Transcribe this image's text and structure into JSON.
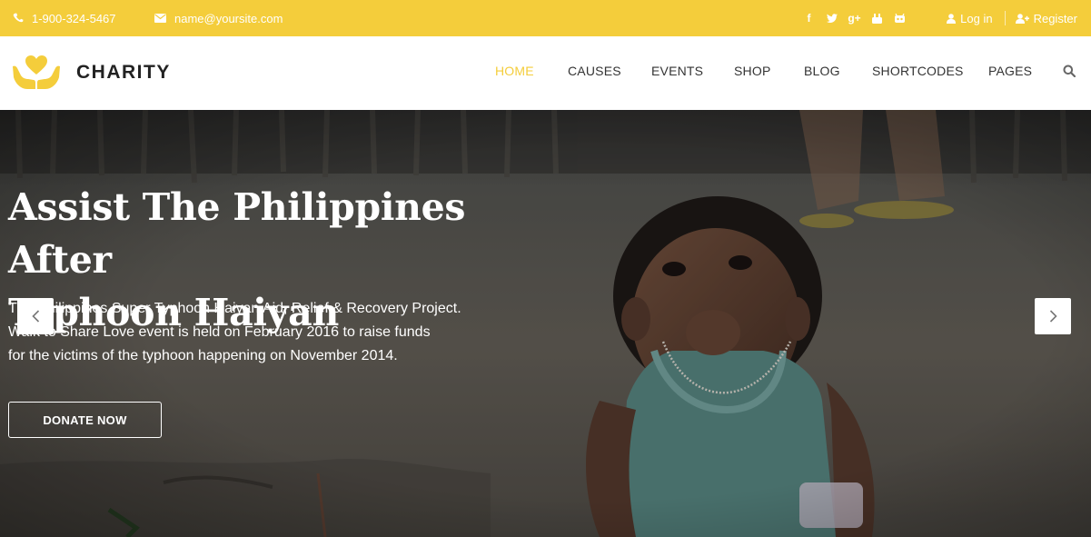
{
  "topbar": {
    "phone": "1-900-324-5467",
    "email": "name@yoursite.com",
    "social": [
      {
        "icon": "facebook-icon",
        "glyph": "f"
      },
      {
        "icon": "twitter-icon",
        "glyph": "t"
      },
      {
        "icon": "google-plus-icon",
        "glyph": "g+"
      },
      {
        "icon": "youtube-icon",
        "glyph": "▶"
      },
      {
        "icon": "flickr-icon",
        "glyph": "◉"
      }
    ],
    "login": "Log in",
    "register": "Register",
    "bg_color": "#f4cd3b"
  },
  "brand": {
    "name": "CHARITY",
    "accent": "#f4cd3b"
  },
  "nav": {
    "items": [
      "HOME",
      "CAUSES",
      "EVENTS",
      "SHOP",
      "BLOG",
      "SHORTCODES",
      "PAGES"
    ],
    "active": "HOME"
  },
  "hero": {
    "title_line1": "Assist The Philippines After",
    "title_line2": "Typhoon Haiyan",
    "desc_line1": "The Philippines Super Typhoon Haiyan Aid, Relief & Recovery Project.",
    "desc_line2": "Walk to Share Love event is held on February 2016 to raise funds",
    "desc_line3": "for the victims of the typhoon happening on November 2014.",
    "button": "DONATE NOW"
  }
}
